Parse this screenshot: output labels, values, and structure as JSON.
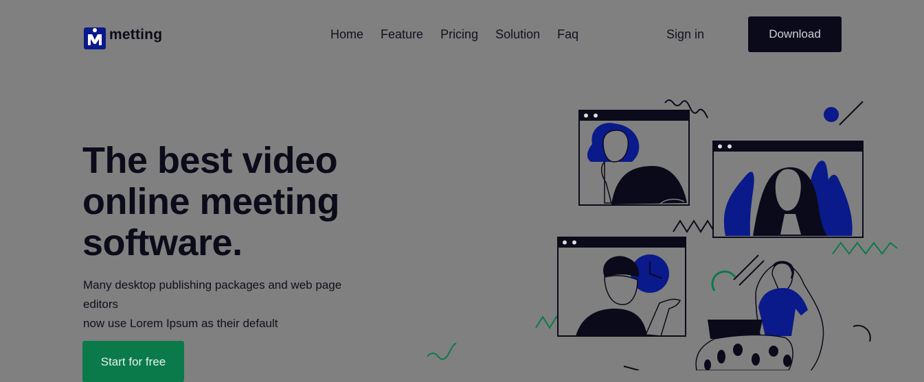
{
  "brand": {
    "name": "metting",
    "logo_letter": "M"
  },
  "nav": {
    "items": [
      "Home",
      "Feature",
      "Pricing",
      "Solution",
      "Faq"
    ]
  },
  "header": {
    "signin_label": "Sign in",
    "download_label": "Download"
  },
  "hero": {
    "title_lines": [
      "The best video",
      "online meeting",
      "software."
    ],
    "description_lines": [
      "Many desktop publishing packages and web page",
      "editors",
      "now use Lorem Ipsum as their default"
    ],
    "cta_label": "Start for free"
  },
  "colors": {
    "background": "#808080",
    "dark": "#0a0a1a",
    "accent_blue": "#0a1a8a",
    "accent_green": "#0b7a4b"
  }
}
